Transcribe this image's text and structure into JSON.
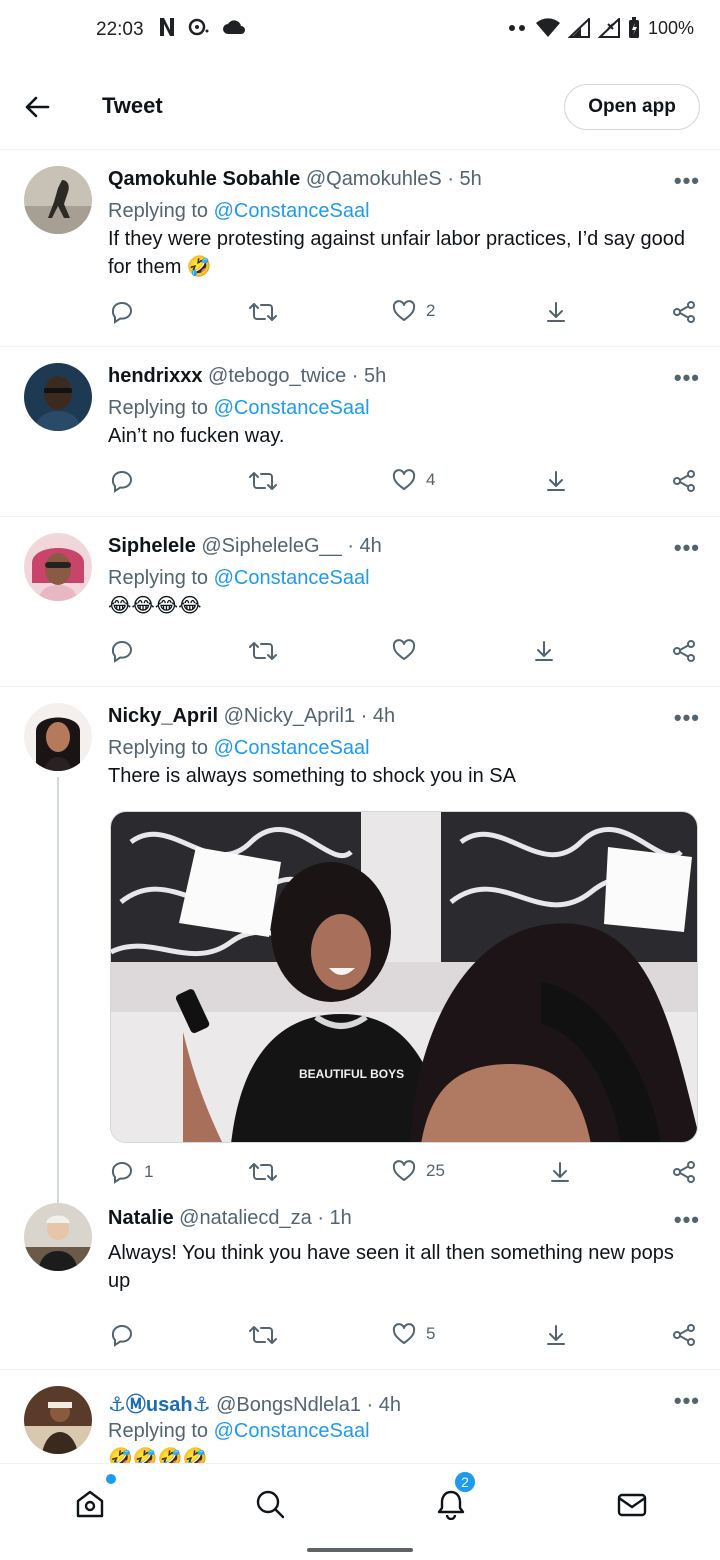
{
  "status_bar": {
    "time": "22:03",
    "battery": "100%"
  },
  "topbar": {
    "title": "Tweet",
    "open_app": "Open app"
  },
  "tweets": [
    {
      "name": "Qamokuhle Sobahle",
      "handle": "@QamokuhleS",
      "time": "5h",
      "replying_label": "Replying to",
      "replying_to": "@ConstanceSaal",
      "text": "If they were protesting against unfair labor practices, I’d say good for them 🤣",
      "replies": "",
      "likes": "2"
    },
    {
      "name": "hendrixxx",
      "handle": "@tebogo_twice",
      "time": "5h",
      "replying_label": "Replying to",
      "replying_to": "@ConstanceSaal",
      "text": "Ain’t no fucken way.",
      "replies": "",
      "likes": "4"
    },
    {
      "name": "Siphelele",
      "handle": "@SipheleleG__",
      "time": "4h",
      "replying_label": "Replying to",
      "replying_to": "@ConstanceSaal",
      "text": "😂😂😂😂",
      "replies": "",
      "likes": ""
    },
    {
      "name": "Nicky_April",
      "handle": "@Nicky_April1",
      "time": "4h",
      "replying_label": "Replying to",
      "replying_to": "@ConstanceSaal",
      "text": "There is always something to shock you in SA",
      "replies": "1",
      "likes": "25",
      "media_text": "BEAUTIFUL BOYS"
    },
    {
      "name": "Natalie",
      "handle": "@nataliecd_za",
      "time": "1h",
      "text": "Always! You think you have seen it all then something new pops up",
      "replies": "",
      "likes": "5"
    },
    {
      "name": "⚓Ⓜusah⚓",
      "handle": "@BongsNdlela1",
      "time": "4h",
      "replying_label": "Replying to",
      "replying_to": "@ConstanceSaal",
      "text": "🤣🤣🤣🤣"
    }
  ],
  "bottom_nav": {
    "notifications_badge": "2"
  },
  "icons": [
    "back-arrow-icon",
    "reply-icon",
    "retweet-icon",
    "like-icon",
    "download-icon",
    "share-icon",
    "more-icon",
    "home-icon",
    "search-icon",
    "bell-icon",
    "mail-icon"
  ]
}
